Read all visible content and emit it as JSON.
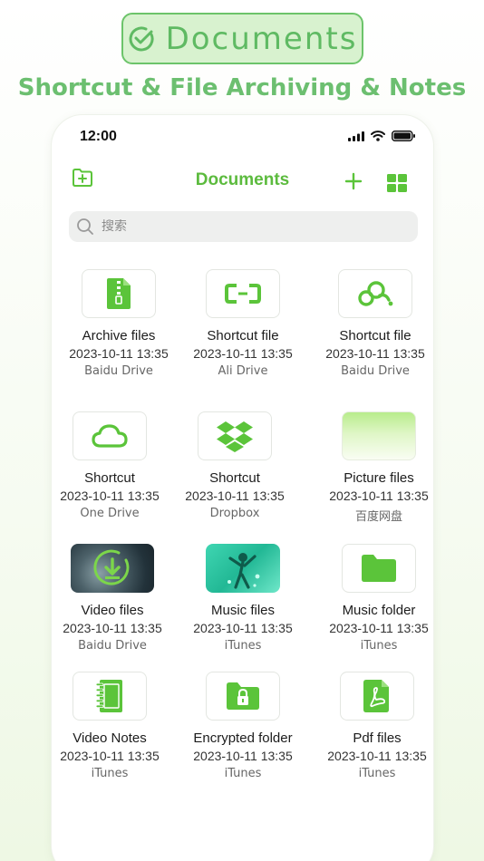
{
  "badge": {
    "label": "Documents"
  },
  "tagline": "Shortcut & File Archiving & Notes",
  "status": {
    "time": "12:00"
  },
  "topbar": {
    "title": "Documents"
  },
  "search": {
    "placeholder": "搜索"
  },
  "colors": {
    "accent": "#5cbb3e",
    "icon_green": "#5bc43a",
    "badge_bg": "#d8f2cf"
  },
  "files": [
    {
      "name": "Archive files",
      "date": "2023-10-11 13:35",
      "source": "Baidu Drive",
      "icon": "archive-file-icon"
    },
    {
      "name": "Shortcut file",
      "date": "2023-10-11 13:35",
      "source": "Ali Drive",
      "icon": "ali-cloud-icon"
    },
    {
      "name": "Shortcut file",
      "date": "2023-10-11 13:35",
      "source": "Baidu Drive",
      "icon": "baidu-cloud-icon"
    },
    {
      "name": "Shortcut",
      "date": "2023-10-11 13:35",
      "source": "One Drive",
      "icon": "cloud-icon"
    },
    {
      "name": "Shortcut",
      "date": "2023-10-11 13:35",
      "source": "Dropbox",
      "icon": "dropbox-icon"
    },
    {
      "name": "Picture files",
      "date": "2023-10-11 13:35",
      "source": "百度网盘",
      "icon": "picture-thumbnail"
    },
    {
      "name": "Video files",
      "date": "2023-10-11 13:35",
      "source": "Baidu Drive",
      "icon": "video-thumbnail"
    },
    {
      "name": "Music files",
      "date": "2023-10-11 13:35",
      "source": "iTunes",
      "icon": "music-thumbnail"
    },
    {
      "name": "Music folder",
      "date": "2023-10-11 13:35",
      "source": "iTunes",
      "icon": "folder-icon"
    },
    {
      "name": "Video Notes",
      "date": "2023-10-11 13:35",
      "source": "iTunes",
      "icon": "notebook-icon"
    },
    {
      "name": "Encrypted folder",
      "date": "2023-10-11 13:35",
      "source": "iTunes",
      "icon": "lock-folder-icon"
    },
    {
      "name": "Pdf files",
      "date": "2023-10-11 13:35",
      "source": "iTunes",
      "icon": "pdf-file-icon"
    }
  ]
}
